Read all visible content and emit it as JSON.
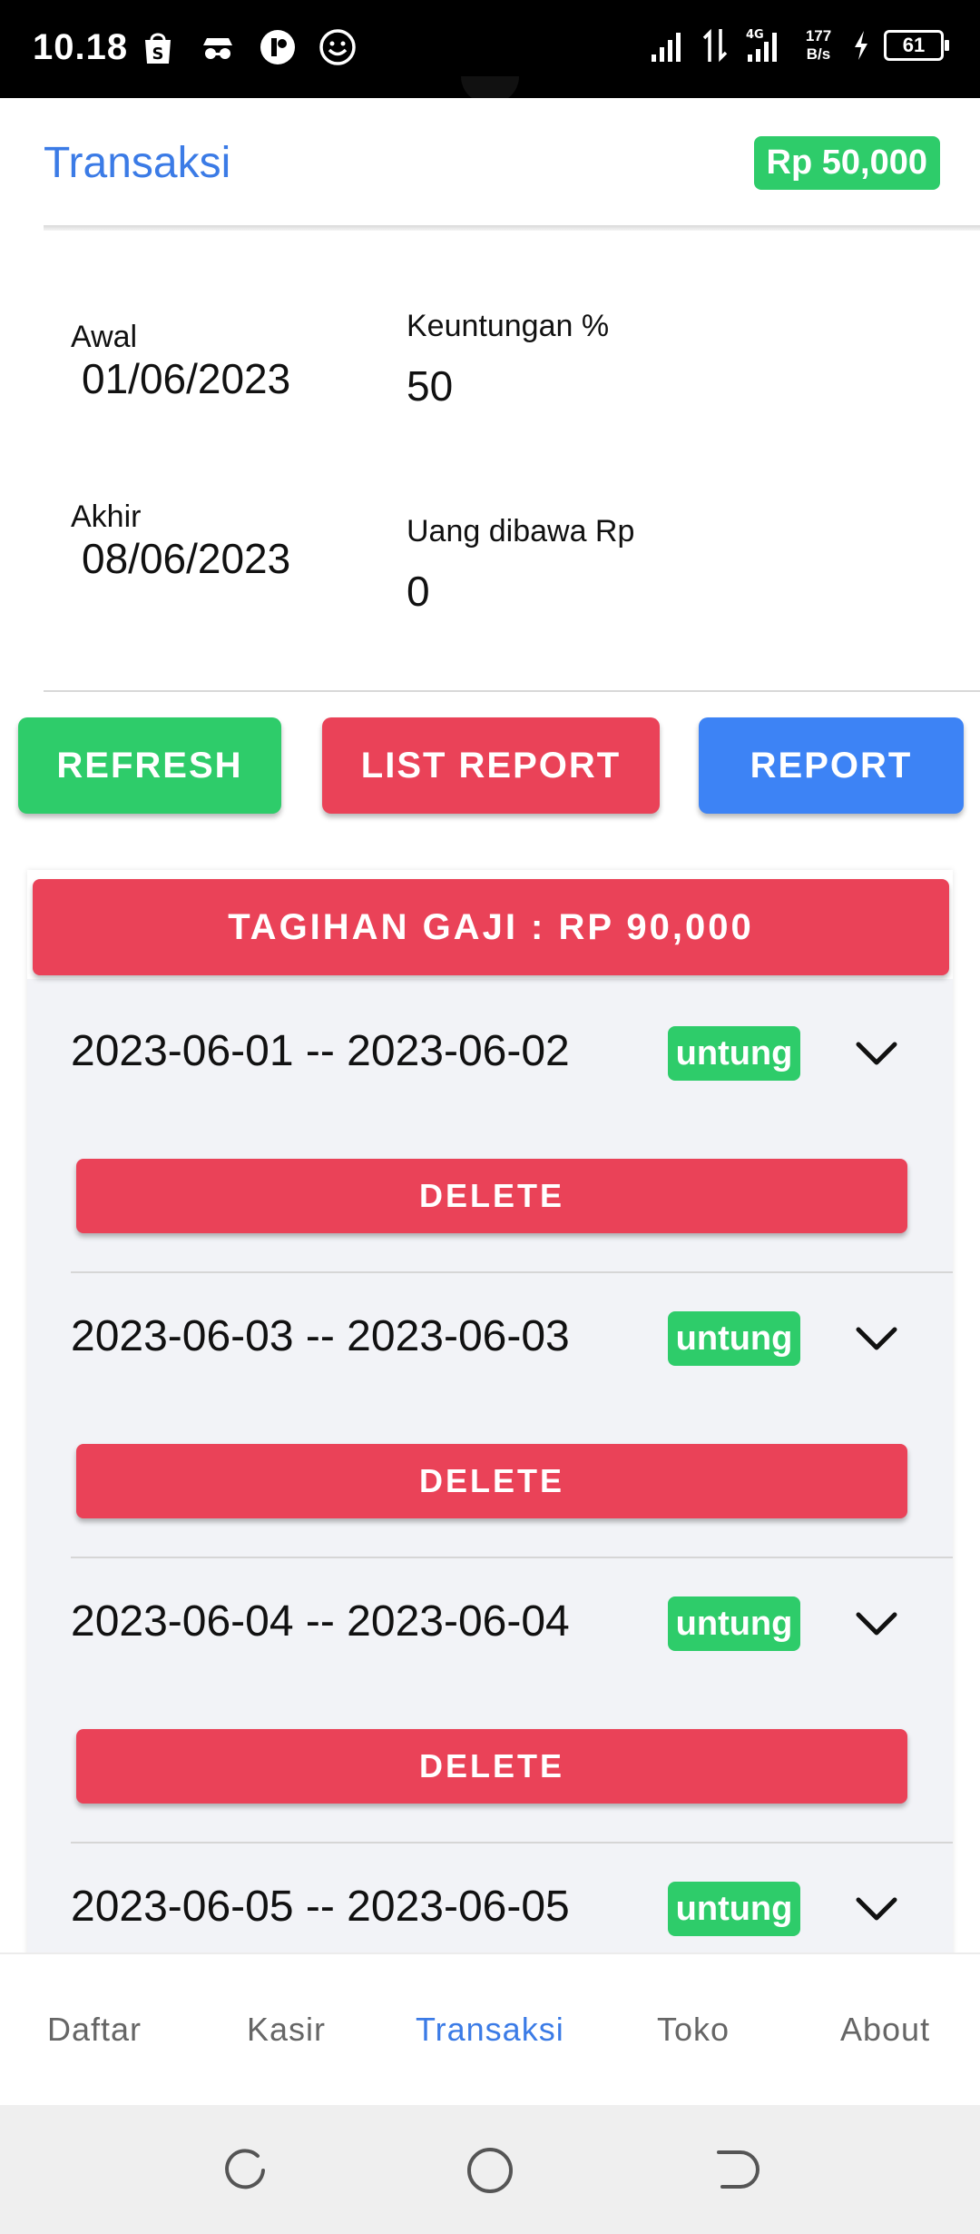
{
  "status_bar": {
    "time": "10.18",
    "speed_value": "177",
    "speed_unit": "B/s",
    "network_label": "4G",
    "battery": "61",
    "notification_icons": [
      "shopee-icon",
      "incognito-icon",
      "fb-lite-icon",
      "smiley-icon"
    ]
  },
  "header": {
    "title": "Transaksi",
    "balance": "Rp 50,000"
  },
  "form": {
    "start_label": "Awal",
    "start_value": "01/06/2023",
    "end_label": "Akhir",
    "end_value": "08/06/2023",
    "profit_label": "Keuntungan %",
    "profit_value": "50",
    "cash_label": "Uang dibawa Rp",
    "cash_value": "0"
  },
  "actions": {
    "refresh": "REFRESH",
    "list_report": "LIST REPORT",
    "report": "REPORT"
  },
  "salary_banner": "TAGIHAN GAJI : RP 90,000",
  "transactions": [
    {
      "period": "2023-06-01 -- 2023-06-02",
      "status": "untung",
      "delete_label": "DELETE"
    },
    {
      "period": "2023-06-03 -- 2023-06-03",
      "status": "untung",
      "delete_label": "DELETE"
    },
    {
      "period": "2023-06-04 -- 2023-06-04",
      "status": "untung",
      "delete_label": "DELETE"
    },
    {
      "period": "2023-06-05 -- 2023-06-05",
      "status": "untung"
    }
  ],
  "bottom_nav": {
    "items": [
      "Daftar",
      "Kasir",
      "Transaksi",
      "Toko",
      "About"
    ],
    "active": "Transaksi"
  },
  "colors": {
    "accent_blue": "#3b7be6",
    "success_green": "#2ecc6a",
    "danger_red": "#ea4258",
    "report_blue": "#3d83f5"
  }
}
